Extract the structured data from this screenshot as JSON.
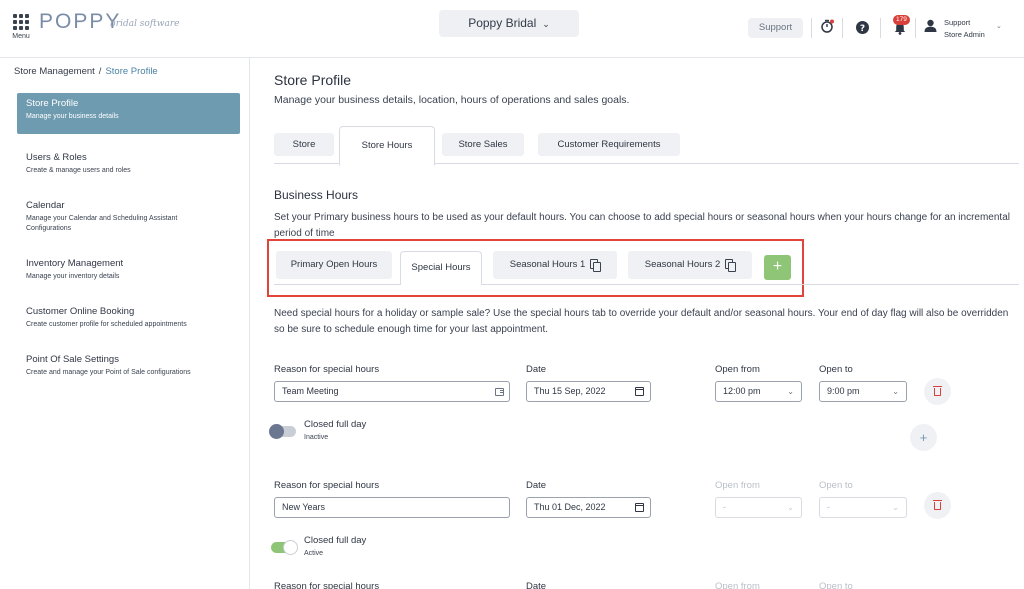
{
  "header": {
    "menu_label": "Menu",
    "logo": "POPPY",
    "logo_sub": "bridal software",
    "store_name": "Poppy Bridal",
    "support_label": "Support",
    "notification_count": "179",
    "user_name": "Support",
    "user_role": "Store Admin"
  },
  "breadcrumb": {
    "root": "Store Management",
    "separator": "/",
    "current": "Store Profile"
  },
  "sidebar": {
    "items": [
      {
        "title": "Store Profile",
        "sub": "Manage your business details"
      },
      {
        "title": "Users & Roles",
        "sub": "Create & manage users and roles"
      },
      {
        "title": "Calendar",
        "sub": "Manage your Calendar and Scheduling Assistant Configurations"
      },
      {
        "title": "Inventory Management",
        "sub": "Manage your inventory details"
      },
      {
        "title": "Customer Online Booking",
        "sub": "Create customer profile for scheduled appointments"
      },
      {
        "title": "Point Of Sale Settings",
        "sub": "Create and manage your Point of Sale configurations"
      }
    ]
  },
  "main": {
    "title": "Store Profile",
    "subtitle": "Manage your business details, location, hours of operations and sales goals.",
    "tabs": [
      "Store",
      "Store Hours",
      "Store Sales",
      "Customer Requirements"
    ],
    "section_title": "Business Hours",
    "section_desc": "Set your Primary business hours to be used as your default hours. You can choose to add special hours or seasonal hours when your hours change for an incremental period of time",
    "hours_tabs": [
      "Primary Open Hours",
      "Special Hours",
      "Seasonal Hours 1",
      "Seasonal Hours 2"
    ],
    "add_label": "+",
    "note": "Need special hours for a holiday or sample sale? Use the special hours tab to override your default and/or seasonal hours. Your end of day flag will also be overridden so be sure to schedule enough time for your last appointment."
  },
  "labels": {
    "reason": "Reason for special hours",
    "date": "Date",
    "open_from": "Open from",
    "open_to": "Open to",
    "closed_full_day": "Closed full day"
  },
  "special_hours": [
    {
      "reason": "Team Meeting",
      "date": "Thu 15 Sep, 2022",
      "open_from": "12:00 pm",
      "open_to": "9:00 pm",
      "closed_state": "Inactive"
    },
    {
      "reason": "New Years",
      "date": "Thu 01 Dec, 2022",
      "open_from": "-",
      "open_to": "-",
      "closed_state": "Active"
    }
  ],
  "colors": {
    "accent": "#6e9bb0",
    "add_green": "#8fc577",
    "highlight_red": "#e0443b",
    "badge_red": "#d9403a"
  }
}
